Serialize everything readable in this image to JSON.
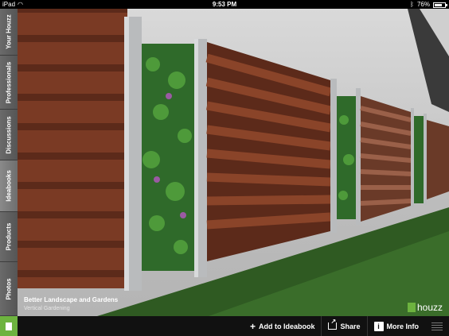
{
  "status_bar": {
    "device": "iPad",
    "time": "9:53 PM",
    "battery": "76%",
    "battery_level": 0.76
  },
  "sidenav": {
    "tabs": [
      {
        "label": "Your Houzz"
      },
      {
        "label": "Professionals"
      },
      {
        "label": "Discussions"
      },
      {
        "label": "Ideabooks"
      },
      {
        "label": "Products"
      },
      {
        "label": "Photos"
      }
    ],
    "active_tab": "Ideabooks"
  },
  "photo": {
    "title": "Better Landscape and Gardens",
    "subtitle": "Vertical Gardening"
  },
  "brand": {
    "name": "houzz",
    "color": "#6db33f"
  },
  "toolbar": {
    "add_label": "Add to Ideabook",
    "share_label": "Share",
    "info_label": "More Info"
  }
}
